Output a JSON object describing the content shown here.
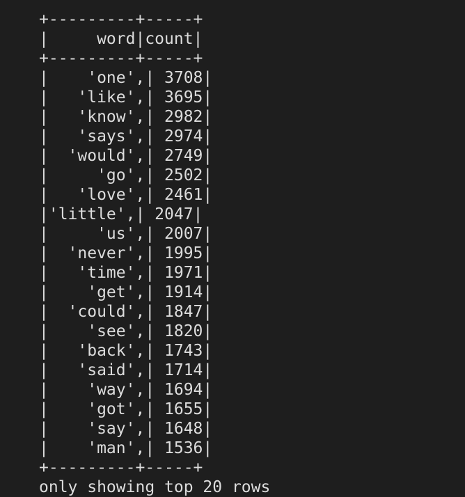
{
  "terminal": {
    "border": "+---------+-----+",
    "header": "|     word|count|",
    "rows": [
      "|    'one',| 3708|",
      "|   'like',| 3695|",
      "|   'know',| 2982|",
      "|   'says',| 2974|",
      "|  'would',| 2749|",
      "|     'go',| 2502|",
      "|   'love',| 2461|",
      "|'little',| 2047|",
      "|     'us',| 2007|",
      "|  'never',| 1995|",
      "|   'time',| 1971|",
      "|    'get',| 1914|",
      "|  'could',| 1847|",
      "|    'see',| 1820|",
      "|   'back',| 1743|",
      "|   'said',| 1714|",
      "|    'way',| 1694|",
      "|    'got',| 1655|",
      "|    'say',| 1648|",
      "|    'man',| 1536|"
    ],
    "footer": "only showing top 20 rows"
  }
}
